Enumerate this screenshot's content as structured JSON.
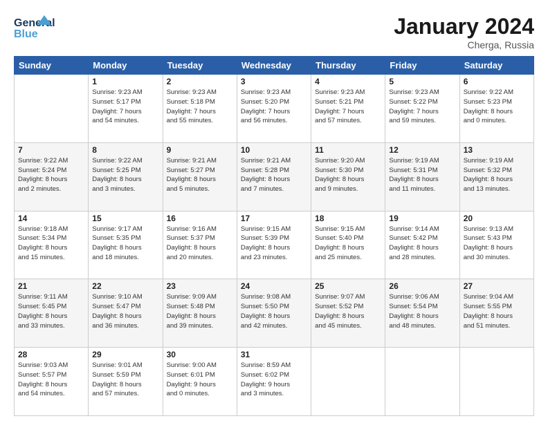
{
  "header": {
    "logo_line1": "General",
    "logo_line2": "Blue",
    "month": "January 2024",
    "location": "Cherga, Russia"
  },
  "weekdays": [
    "Sunday",
    "Monday",
    "Tuesday",
    "Wednesday",
    "Thursday",
    "Friday",
    "Saturday"
  ],
  "weeks": [
    [
      {
        "day": "",
        "info": ""
      },
      {
        "day": "1",
        "info": "Sunrise: 9:23 AM\nSunset: 5:17 PM\nDaylight: 7 hours\nand 54 minutes."
      },
      {
        "day": "2",
        "info": "Sunrise: 9:23 AM\nSunset: 5:18 PM\nDaylight: 7 hours\nand 55 minutes."
      },
      {
        "day": "3",
        "info": "Sunrise: 9:23 AM\nSunset: 5:20 PM\nDaylight: 7 hours\nand 56 minutes."
      },
      {
        "day": "4",
        "info": "Sunrise: 9:23 AM\nSunset: 5:21 PM\nDaylight: 7 hours\nand 57 minutes."
      },
      {
        "day": "5",
        "info": "Sunrise: 9:23 AM\nSunset: 5:22 PM\nDaylight: 7 hours\nand 59 minutes."
      },
      {
        "day": "6",
        "info": "Sunrise: 9:22 AM\nSunset: 5:23 PM\nDaylight: 8 hours\nand 0 minutes."
      }
    ],
    [
      {
        "day": "7",
        "info": "Sunrise: 9:22 AM\nSunset: 5:24 PM\nDaylight: 8 hours\nand 2 minutes."
      },
      {
        "day": "8",
        "info": "Sunrise: 9:22 AM\nSunset: 5:25 PM\nDaylight: 8 hours\nand 3 minutes."
      },
      {
        "day": "9",
        "info": "Sunrise: 9:21 AM\nSunset: 5:27 PM\nDaylight: 8 hours\nand 5 minutes."
      },
      {
        "day": "10",
        "info": "Sunrise: 9:21 AM\nSunset: 5:28 PM\nDaylight: 8 hours\nand 7 minutes."
      },
      {
        "day": "11",
        "info": "Sunrise: 9:20 AM\nSunset: 5:30 PM\nDaylight: 8 hours\nand 9 minutes."
      },
      {
        "day": "12",
        "info": "Sunrise: 9:19 AM\nSunset: 5:31 PM\nDaylight: 8 hours\nand 11 minutes."
      },
      {
        "day": "13",
        "info": "Sunrise: 9:19 AM\nSunset: 5:32 PM\nDaylight: 8 hours\nand 13 minutes."
      }
    ],
    [
      {
        "day": "14",
        "info": "Sunrise: 9:18 AM\nSunset: 5:34 PM\nDaylight: 8 hours\nand 15 minutes."
      },
      {
        "day": "15",
        "info": "Sunrise: 9:17 AM\nSunset: 5:35 PM\nDaylight: 8 hours\nand 18 minutes."
      },
      {
        "day": "16",
        "info": "Sunrise: 9:16 AM\nSunset: 5:37 PM\nDaylight: 8 hours\nand 20 minutes."
      },
      {
        "day": "17",
        "info": "Sunrise: 9:15 AM\nSunset: 5:39 PM\nDaylight: 8 hours\nand 23 minutes."
      },
      {
        "day": "18",
        "info": "Sunrise: 9:15 AM\nSunset: 5:40 PM\nDaylight: 8 hours\nand 25 minutes."
      },
      {
        "day": "19",
        "info": "Sunrise: 9:14 AM\nSunset: 5:42 PM\nDaylight: 8 hours\nand 28 minutes."
      },
      {
        "day": "20",
        "info": "Sunrise: 9:13 AM\nSunset: 5:43 PM\nDaylight: 8 hours\nand 30 minutes."
      }
    ],
    [
      {
        "day": "21",
        "info": "Sunrise: 9:11 AM\nSunset: 5:45 PM\nDaylight: 8 hours\nand 33 minutes."
      },
      {
        "day": "22",
        "info": "Sunrise: 9:10 AM\nSunset: 5:47 PM\nDaylight: 8 hours\nand 36 minutes."
      },
      {
        "day": "23",
        "info": "Sunrise: 9:09 AM\nSunset: 5:48 PM\nDaylight: 8 hours\nand 39 minutes."
      },
      {
        "day": "24",
        "info": "Sunrise: 9:08 AM\nSunset: 5:50 PM\nDaylight: 8 hours\nand 42 minutes."
      },
      {
        "day": "25",
        "info": "Sunrise: 9:07 AM\nSunset: 5:52 PM\nDaylight: 8 hours\nand 45 minutes."
      },
      {
        "day": "26",
        "info": "Sunrise: 9:06 AM\nSunset: 5:54 PM\nDaylight: 8 hours\nand 48 minutes."
      },
      {
        "day": "27",
        "info": "Sunrise: 9:04 AM\nSunset: 5:55 PM\nDaylight: 8 hours\nand 51 minutes."
      }
    ],
    [
      {
        "day": "28",
        "info": "Sunrise: 9:03 AM\nSunset: 5:57 PM\nDaylight: 8 hours\nand 54 minutes."
      },
      {
        "day": "29",
        "info": "Sunrise: 9:01 AM\nSunset: 5:59 PM\nDaylight: 8 hours\nand 57 minutes."
      },
      {
        "day": "30",
        "info": "Sunrise: 9:00 AM\nSunset: 6:01 PM\nDaylight: 9 hours\nand 0 minutes."
      },
      {
        "day": "31",
        "info": "Sunrise: 8:59 AM\nSunset: 6:02 PM\nDaylight: 9 hours\nand 3 minutes."
      },
      {
        "day": "",
        "info": ""
      },
      {
        "day": "",
        "info": ""
      },
      {
        "day": "",
        "info": ""
      }
    ]
  ]
}
